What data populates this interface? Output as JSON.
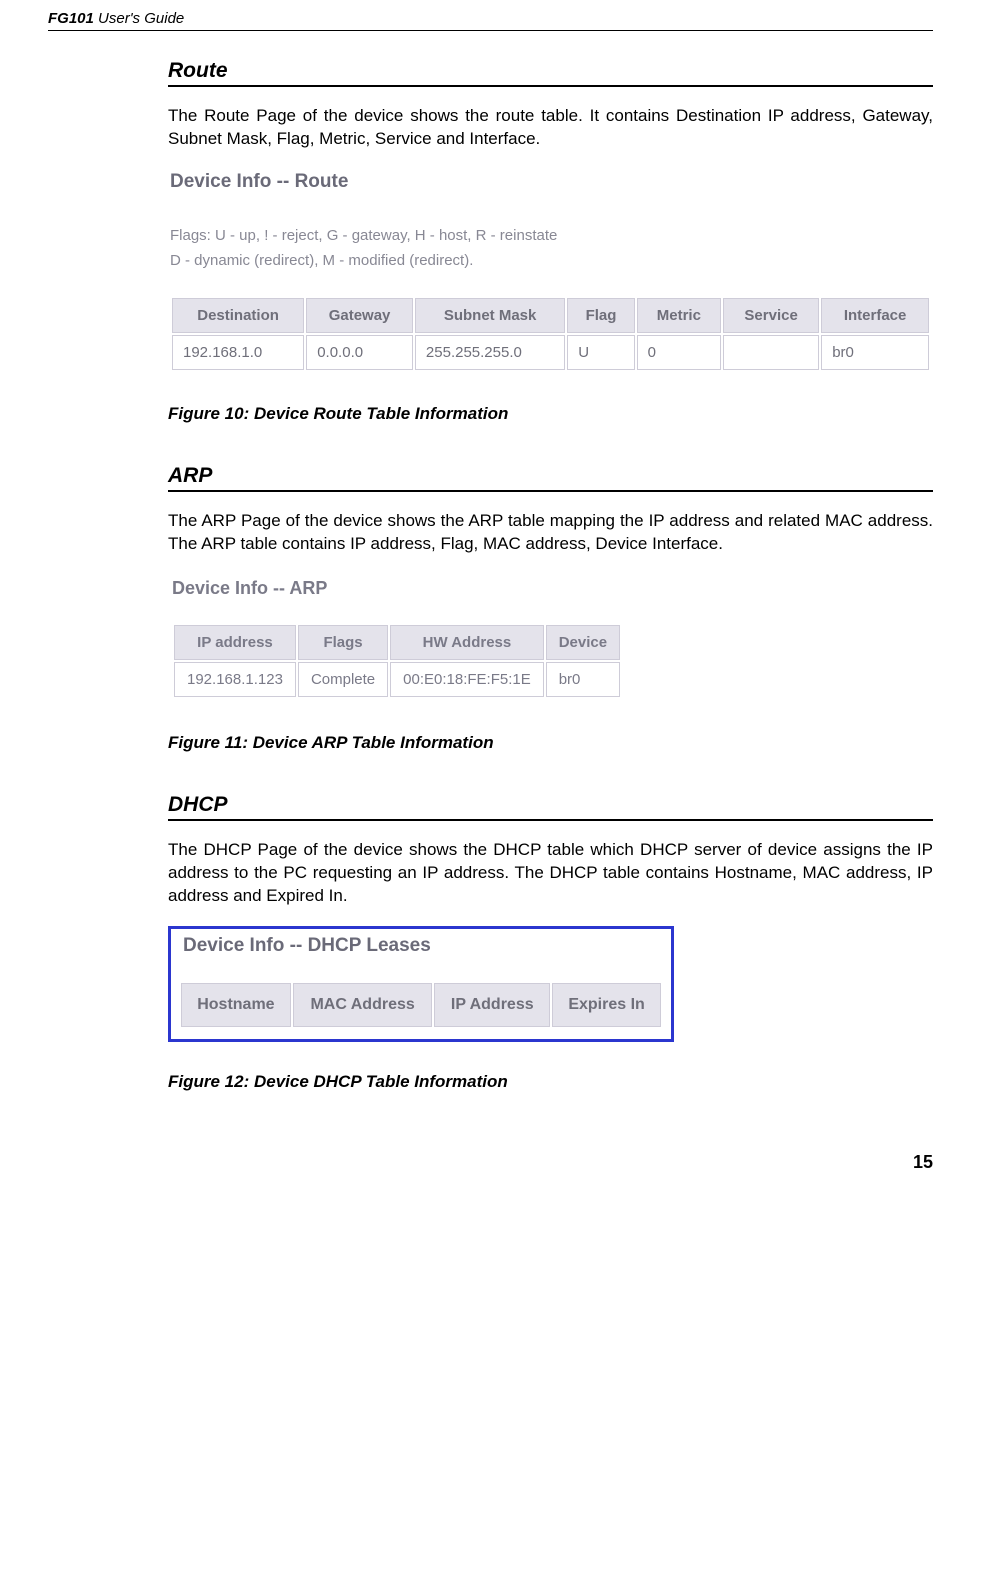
{
  "header": {
    "product": "FG101",
    "guide": " User's Guide"
  },
  "page_number": "15",
  "sections": {
    "route": {
      "heading": "Route",
      "body": "The Route Page of the device shows the route table. It contains Destination IP address, Gateway, Subnet Mask, Flag, Metric, Service and Interface.",
      "figure_title": "Device Info -- Route",
      "flags_line1": "Flags: U - up, ! - reject, G - gateway, H - host, R - reinstate",
      "flags_line2": "D - dynamic (redirect), M - modified (redirect).",
      "table": {
        "headers": [
          "Destination",
          "Gateway",
          "Subnet Mask",
          "Flag",
          "Metric",
          "Service",
          "Interface"
        ],
        "row": [
          "192.168.1.0",
          "0.0.0.0",
          "255.255.255.0",
          "U",
          "0",
          "",
          "br0"
        ]
      },
      "caption": "Figure 10: Device Route Table Information"
    },
    "arp": {
      "heading": "ARP",
      "body": "The ARP Page of the device shows the ARP table mapping the IP address and related MAC address. The ARP table contains IP address, Flag, MAC address, Device Interface.",
      "figure_title": "Device Info -- ARP",
      "table": {
        "headers": [
          "IP address",
          "Flags",
          "HW Address",
          "Device"
        ],
        "row": [
          "192.168.1.123",
          "Complete",
          "00:E0:18:FE:F5:1E",
          "br0"
        ]
      },
      "caption": "Figure 11: Device ARP Table Information"
    },
    "dhcp": {
      "heading": "DHCP",
      "body": "The DHCP Page of the device shows the DHCP table which DHCP server of device assigns the IP address to the PC requesting an IP address. The DHCP table contains Hostname, MAC address, IP address and Expired In.",
      "figure_title": "Device Info -- DHCP Leases",
      "table": {
        "headers": [
          "Hostname",
          "MAC Address",
          "IP Address",
          "Expires In"
        ]
      },
      "caption": "Figure 12: Device DHCP Table Information"
    }
  }
}
